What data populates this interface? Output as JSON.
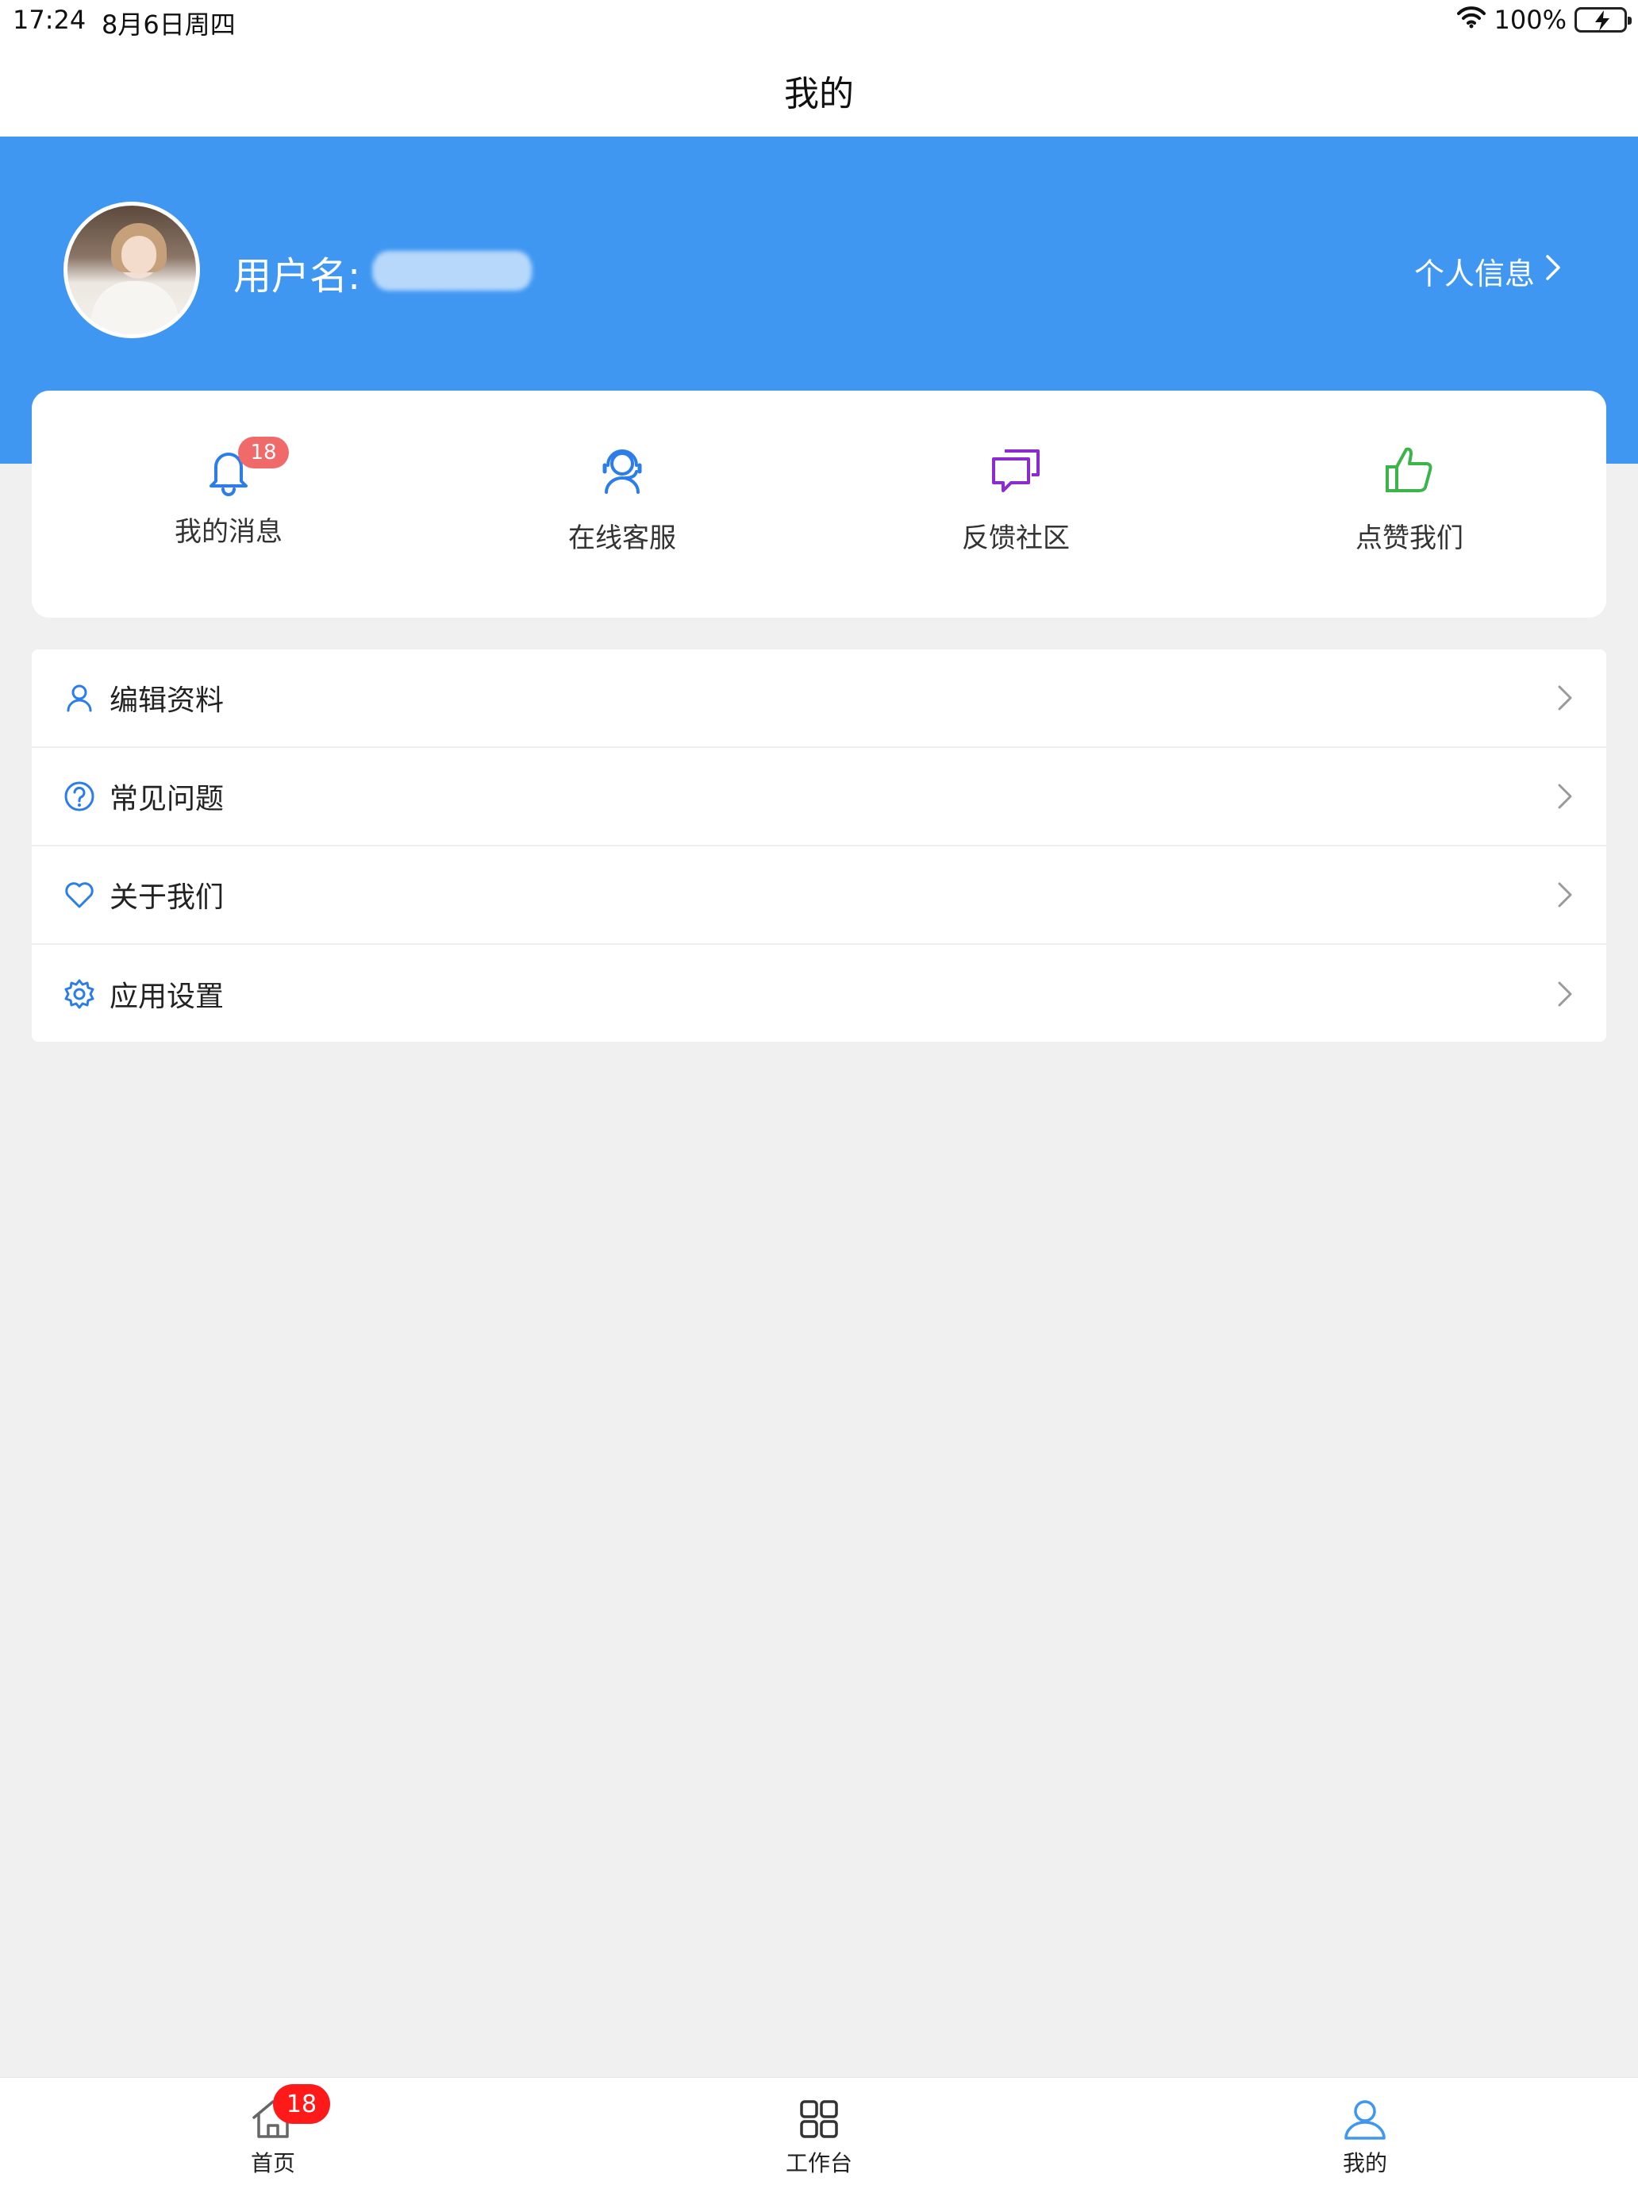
{
  "status_bar": {
    "time": "17:24",
    "date": "8月6日周四",
    "battery": "100%"
  },
  "nav": {
    "title": "我的"
  },
  "profile": {
    "username_label": "用户名:",
    "info_link": "个人信息",
    "header_color": "#3f97f2"
  },
  "quick_actions": [
    {
      "label": "我的消息",
      "icon": "bell-icon",
      "badge": "18",
      "color": "#2b7de9"
    },
    {
      "label": "在线客服",
      "icon": "headset-icon",
      "color": "#2b7de9"
    },
    {
      "label": "反馈社区",
      "icon": "chat-bubbles-icon",
      "color": "#8b2bd0"
    },
    {
      "label": "点赞我们",
      "icon": "thumbs-up-icon",
      "color": "#3bb54a"
    }
  ],
  "menu": [
    {
      "label": "编辑资料",
      "icon": "user-icon"
    },
    {
      "label": "常见问题",
      "icon": "question-circle-icon"
    },
    {
      "label": "关于我们",
      "icon": "heart-icon"
    },
    {
      "label": "应用设置",
      "icon": "gear-icon"
    }
  ],
  "tabs": [
    {
      "label": "首页",
      "icon": "home-icon",
      "badge": "18"
    },
    {
      "label": "工作台",
      "icon": "grid-icon"
    },
    {
      "label": "我的",
      "icon": "user-icon",
      "active": true,
      "active_color": "#3f97f2"
    }
  ]
}
